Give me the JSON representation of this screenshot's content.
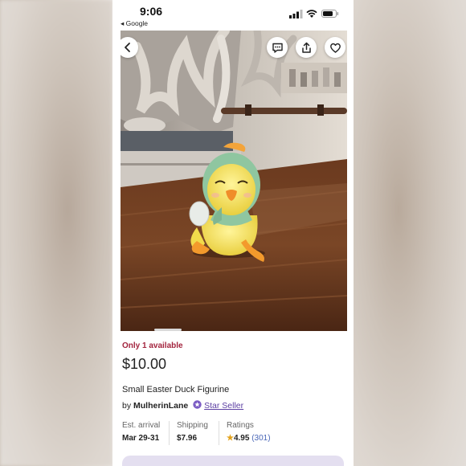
{
  "status_bar": {
    "time": "9:06",
    "back_app": "◂ Google"
  },
  "listing": {
    "availability": "Only 1 available",
    "price": "$10.00",
    "title": "Small Easter Duck Figurine",
    "by_label": "by",
    "seller_name": "MulherinLane",
    "seller_badge": "Star Seller",
    "est_arrival_label": "Est. arrival",
    "est_arrival_value": "Mar 29-31",
    "shipping_label": "Shipping",
    "shipping_value": "$7.96",
    "ratings_label": "Ratings",
    "rating_value": "4.95",
    "rating_count": "(301)"
  },
  "icons": {
    "back": "chevron-left-icon",
    "message": "message-icon",
    "share": "share-icon",
    "favorite": "heart-icon"
  },
  "colors": {
    "availability": "#a3243e",
    "star_seller": "#5c3fa3",
    "rating_star": "#e3a21a"
  }
}
